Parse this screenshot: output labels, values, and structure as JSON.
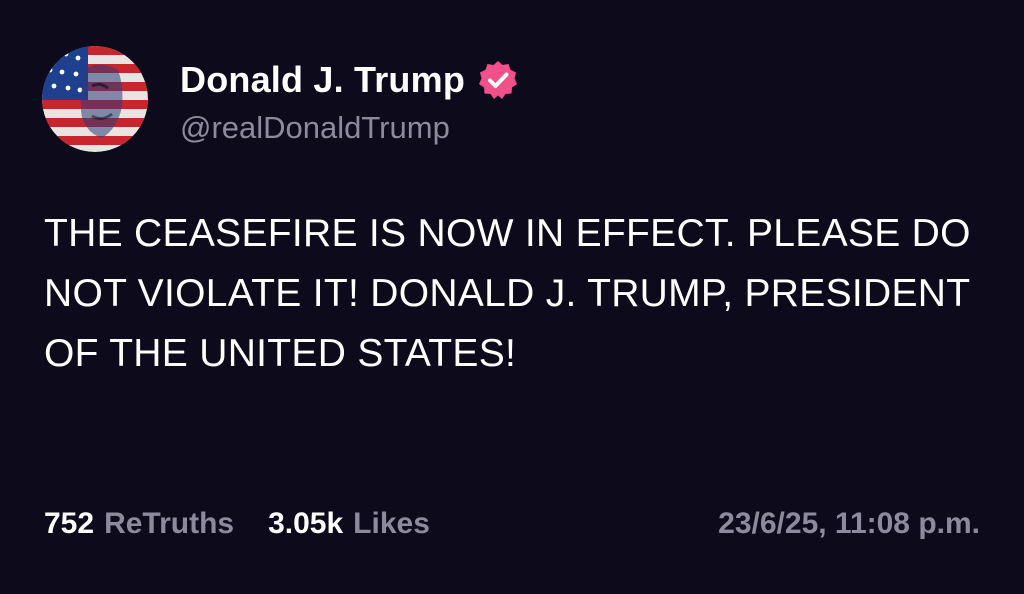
{
  "post": {
    "author": {
      "display_name": "Donald J. Trump",
      "handle": "@realDonaldTrump",
      "verified_icon": "verified-badge-icon",
      "verified_color": "#f2508a"
    },
    "text": "THE CEASEFIRE IS NOW IN EFFECT. PLEASE DO NOT VIOLATE IT! DONALD J. TRUMP, PRESIDENT OF THE UNITED STATES!",
    "stats": {
      "retruths_count": "752",
      "retruths_label": "ReTruths",
      "likes_count": "3.05k",
      "likes_label": "Likes"
    },
    "timestamp": "23/6/25, 11:08 p.m."
  },
  "theme": {
    "background": "#0c0a1b",
    "text_primary": "#ffffff",
    "text_secondary": "#8e8a9e"
  }
}
